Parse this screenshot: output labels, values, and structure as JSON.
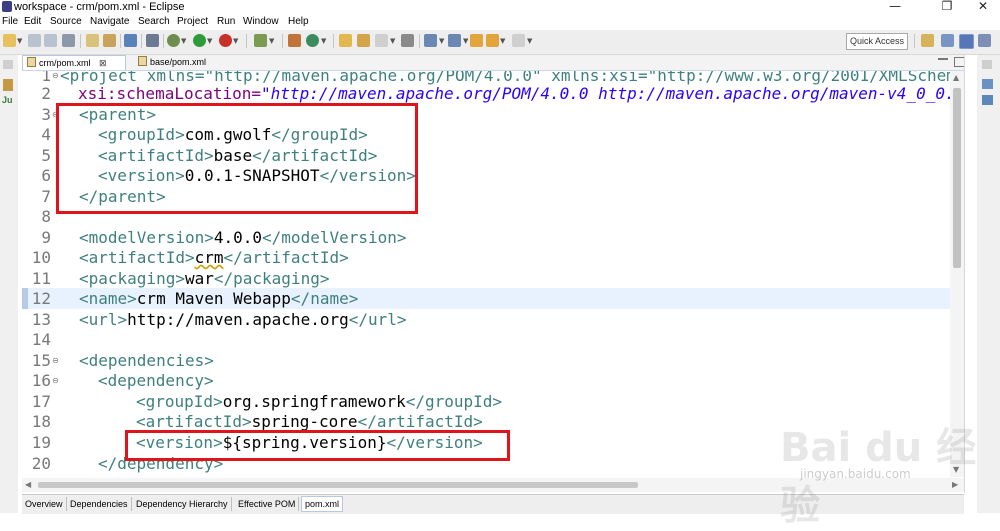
{
  "window": {
    "title": "workspace - crm/pom.xml - Eclipse",
    "minimize": "—",
    "maximize": "❐",
    "close": "✕"
  },
  "menu": [
    "File",
    "Edit",
    "Source",
    "Navigate",
    "Search",
    "Project",
    "Run",
    "Window",
    "Help"
  ],
  "toolbar": {
    "quick_access": "Quick Access"
  },
  "tabs": [
    {
      "label": "crm/pom.xml",
      "close": "⊠",
      "active": true
    },
    {
      "label": "base/pom.xml",
      "active": false
    }
  ],
  "left_trim": {
    "junit_label": "Ju"
  },
  "editor": {
    "line_numbers": [
      "1",
      "2",
      "3",
      "4",
      "5",
      "6",
      "7",
      "8",
      "9",
      "10",
      "11",
      "12",
      "13",
      "14",
      "15",
      "16",
      "17",
      "18",
      "19",
      "20"
    ],
    "current_line": "12",
    "lines": {
      "l1": "<project xmlns=\"http://maven.apache.org/POM/4.0.0\" xmlns:xsi=\"http://www.w3.org/2001/XMLSchem",
      "l2_attr": "xsi:schemaLocation=",
      "l2_val": "\"http://maven.apache.org/POM/4.0.0 http://maven.apache.org/maven-v4_0_0.",
      "l3": "<parent>",
      "l4_open": "<groupId>",
      "l4_val": "com.gwolf",
      "l4_close": "</groupId>",
      "l5_open": "<artifactId>",
      "l5_val": "base",
      "l5_close": "</artifactId>",
      "l6_open": "<version>",
      "l6_val": "0.0.1-SNAPSHOT",
      "l6_close": "</version>",
      "l7": "</parent>",
      "l9_open": "<modelVersion>",
      "l9_val": "4.0.0",
      "l9_close": "</modelVersion>",
      "l10_open": "<artifactId>",
      "l10_val": "crm",
      "l10_close": "</artifactId>",
      "l11_open": "<packaging>",
      "l11_val": "war",
      "l11_close": "</packaging>",
      "l12_open": "<name>",
      "l12_val": "crm Maven Webapp",
      "l12_close": "</name>",
      "l13_open": "<url>",
      "l13_val": "http://maven.apache.org",
      "l13_close": "</url>",
      "l15": "<dependencies>",
      "l16": "<dependency>",
      "l17_open": "<groupId>",
      "l17_val": "org.springframework",
      "l17_close": "</groupId>",
      "l18_open": "<artifactId>",
      "l18_val": "spring-core",
      "l18_close": "</artifactId>",
      "l19_open": "<version>",
      "l19_val": "${spring.version}",
      "l19_close": "</version>",
      "l20": "</dependency>"
    }
  },
  "bottom_tabs": [
    "Overview",
    "Dependencies",
    "Dependency Hierarchy",
    "Effective POM",
    "pom.xml"
  ],
  "watermark": {
    "logo": "Bai du 经验",
    "url": "jingyan.baidu.com"
  },
  "colors": {
    "tag": "#3f7f7f",
    "attr_value": "#2a00ff",
    "attr_name": "#7f007f",
    "highlight_box": "#e0141b",
    "current_line": "#e8f2fe"
  }
}
